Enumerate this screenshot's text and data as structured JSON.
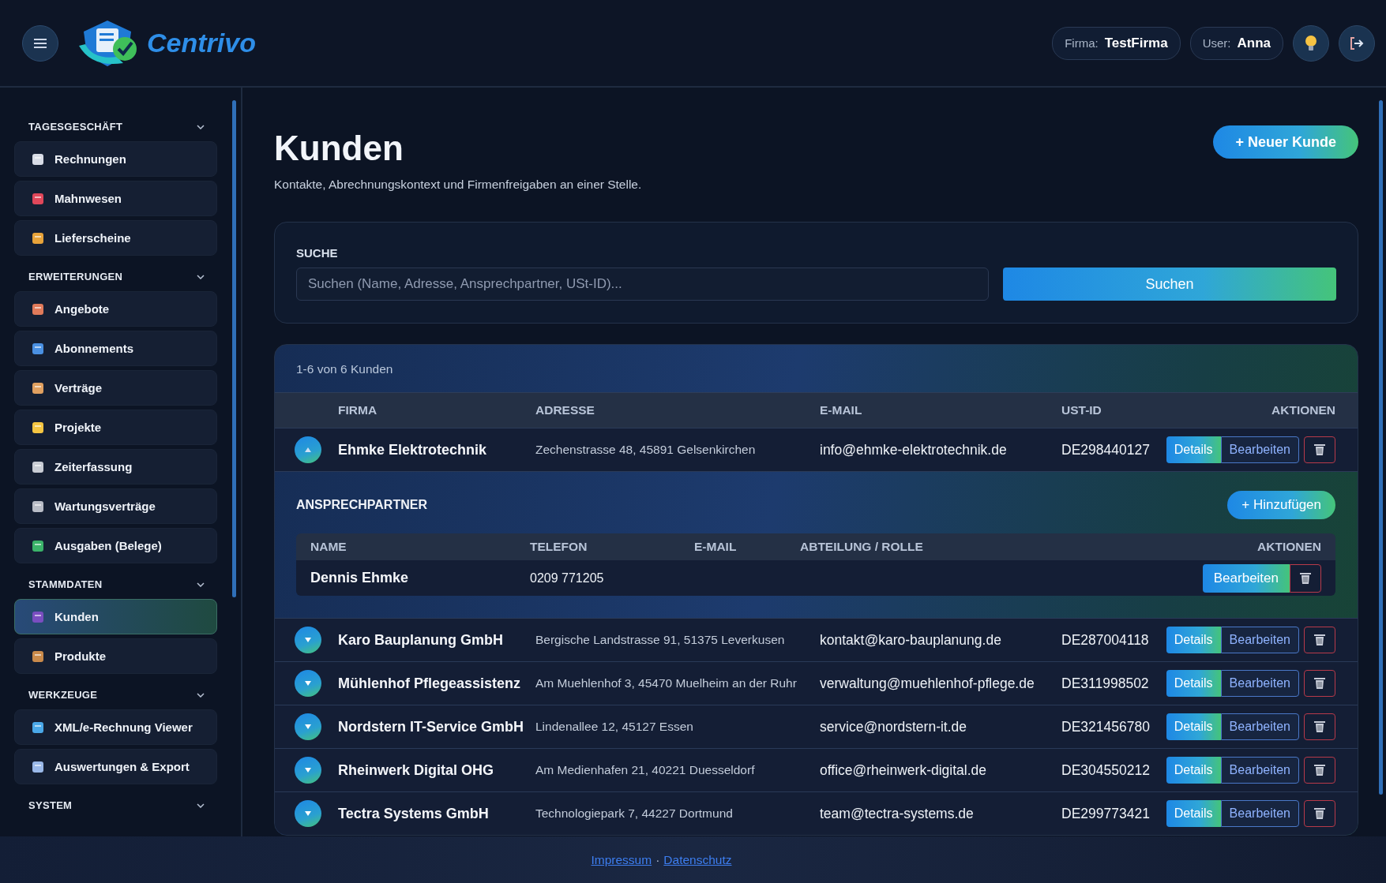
{
  "header": {
    "logo": "Centrivo",
    "firma_label": "Firma:",
    "firma": "TestFirma",
    "user_label": "User:",
    "user": "Anna"
  },
  "sidebar": {
    "sections": [
      {
        "title": "TAGESGESCHÄFT",
        "expanded": true,
        "items": [
          {
            "label": "Rechnungen",
            "selected": false
          },
          {
            "label": "Mahnwesen",
            "selected": false
          },
          {
            "label": "Lieferscheine",
            "selected": false
          }
        ]
      },
      {
        "title": "ERWEITERUNGEN",
        "expanded": true,
        "items": [
          {
            "label": "Angebote",
            "selected": false
          },
          {
            "label": "Abonnements",
            "selected": false
          },
          {
            "label": "Verträge",
            "selected": false
          },
          {
            "label": "Projekte",
            "selected": false
          },
          {
            "label": "Zeiterfassung",
            "selected": false
          },
          {
            "label": "Wartungsverträge",
            "selected": false
          },
          {
            "label": "Ausgaben (Belege)",
            "selected": false
          }
        ]
      },
      {
        "title": "STAMMDATEN",
        "expanded": true,
        "items": [
          {
            "label": "Kunden",
            "selected": true
          },
          {
            "label": "Produkte",
            "selected": false
          }
        ]
      },
      {
        "title": "WERKZEUGE",
        "expanded": true,
        "items": [
          {
            "label": "XML/e-Rechnung Viewer",
            "selected": false
          },
          {
            "label": "Auswertungen & Export",
            "selected": false
          }
        ]
      },
      {
        "title": "SYSTEM",
        "expanded": true
      }
    ]
  },
  "page": {
    "title": "Kunden",
    "subtitle": "Kontakte, Abrechnungskontext und Firmenfreigaben an einer Stelle.",
    "new_button": "+ Neuer Kunde"
  },
  "search": {
    "label": "SUCHE",
    "placeholder": "Suchen (Name, Adresse, Ansprechpartner, USt-ID)...",
    "button": "Suchen"
  },
  "table": {
    "count": "1-6 von 6 Kunden",
    "columns": [
      "FIRMA",
      "ADRESSE",
      "E-MAIL",
      "UST-ID",
      "AKTIONEN"
    ],
    "rows": [
      {
        "firma": "Ehmke Elektrotechnik",
        "adresse": "Zechenstrasse 48, 45891 Gelsenkirchen",
        "email": "info@ehmke-elektrotechnik.de",
        "ust_id": "DE298440127",
        "details": "Details",
        "edit": "Bearbeiten",
        "expanded": true,
        "contacts": {
          "title": "ANSPRECHPARTNER",
          "add_button": "+ Hinzufügen",
          "columns": [
            "NAME",
            "TELEFON",
            "E-MAIL",
            "ABTEILUNG / ROLLE",
            "AKTIONEN"
          ],
          "rows": [
            {
              "name": "Dennis Ehmke",
              "telefon": "0209 771205",
              "edit": "Bearbeiten"
            }
          ]
        }
      },
      {
        "firma": "Karo Bauplanung GmbH",
        "adresse": "Bergische Landstrasse 91, 51375 Leverkusen",
        "email": "kontakt@karo-bauplanung.de",
        "ust_id": "DE287004118",
        "details": "Details",
        "edit": "Bearbeiten",
        "expanded": false
      },
      {
        "firma": "Mühlenhof Pflegeassistenz",
        "adresse": "Am Muehlenhof 3, 45470 Muelheim an der Ruhr",
        "email": "verwaltung@muehlenhof-pflege.de",
        "ust_id": "DE311998502",
        "details": "Details",
        "edit": "Bearbeiten",
        "expanded": false
      },
      {
        "firma": "Nordstern IT-Service GmbH",
        "adresse": "Lindenallee 12, 45127 Essen",
        "email": "service@nordstern-it.de",
        "ust_id": "DE321456780",
        "details": "Details",
        "edit": "Bearbeiten",
        "expanded": false
      },
      {
        "firma": "Rheinwerk Digital OHG",
        "adresse": "Am Medienhafen 21, 40221 Duesseldorf",
        "email": "office@rheinwerk-digital.de",
        "ust_id": "DE304550212",
        "details": "Details",
        "edit": "Bearbeiten",
        "expanded": false
      },
      {
        "firma": "Tectra Systems GmbH",
        "adresse": "Technologiepark 7, 44227 Dortmund",
        "email": "team@tectra-systems.de",
        "ust_id": "DE299773421",
        "details": "Details",
        "edit": "Bearbeiten",
        "expanded": false
      }
    ]
  },
  "footer": {
    "links": [
      "Impressum",
      "Datenschutz"
    ],
    "separator": "·"
  }
}
